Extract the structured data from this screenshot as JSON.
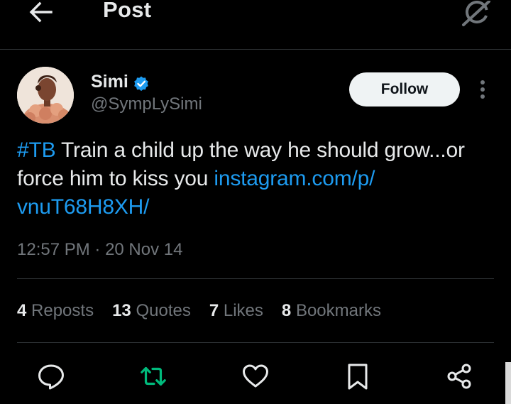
{
  "header": {
    "title": "Post",
    "back_icon": "arrow-left-icon",
    "grok_icon": "grok-icon"
  },
  "author": {
    "display_name": "Simi",
    "handle": "@SympLySimi",
    "verified": true,
    "follow_label": "Follow"
  },
  "tweet": {
    "hashtag": "#TB",
    "text_part1": " Train a child up the way he should grow...or force him to kiss you ",
    "link": "instagram.com/p/ vnuT68H8XH/"
  },
  "meta": {
    "time": "12:57 PM",
    "separator": " · ",
    "date": "20 Nov 14"
  },
  "stats": [
    {
      "count": "4",
      "label": "Reposts"
    },
    {
      "count": "13",
      "label": "Quotes"
    },
    {
      "count": "7",
      "label": "Likes"
    },
    {
      "count": "8",
      "label": "Bookmarks"
    }
  ],
  "actions": [
    "reply-icon",
    "repost-icon",
    "like-icon",
    "bookmark-icon",
    "share-icon"
  ],
  "colors": {
    "background": "#000000",
    "text": "#e7e9ea",
    "muted": "#71767b",
    "link": "#1d9bf0",
    "repost_active": "#00ba7c",
    "divider": "#2f3336",
    "follow_bg": "#eff3f4"
  }
}
